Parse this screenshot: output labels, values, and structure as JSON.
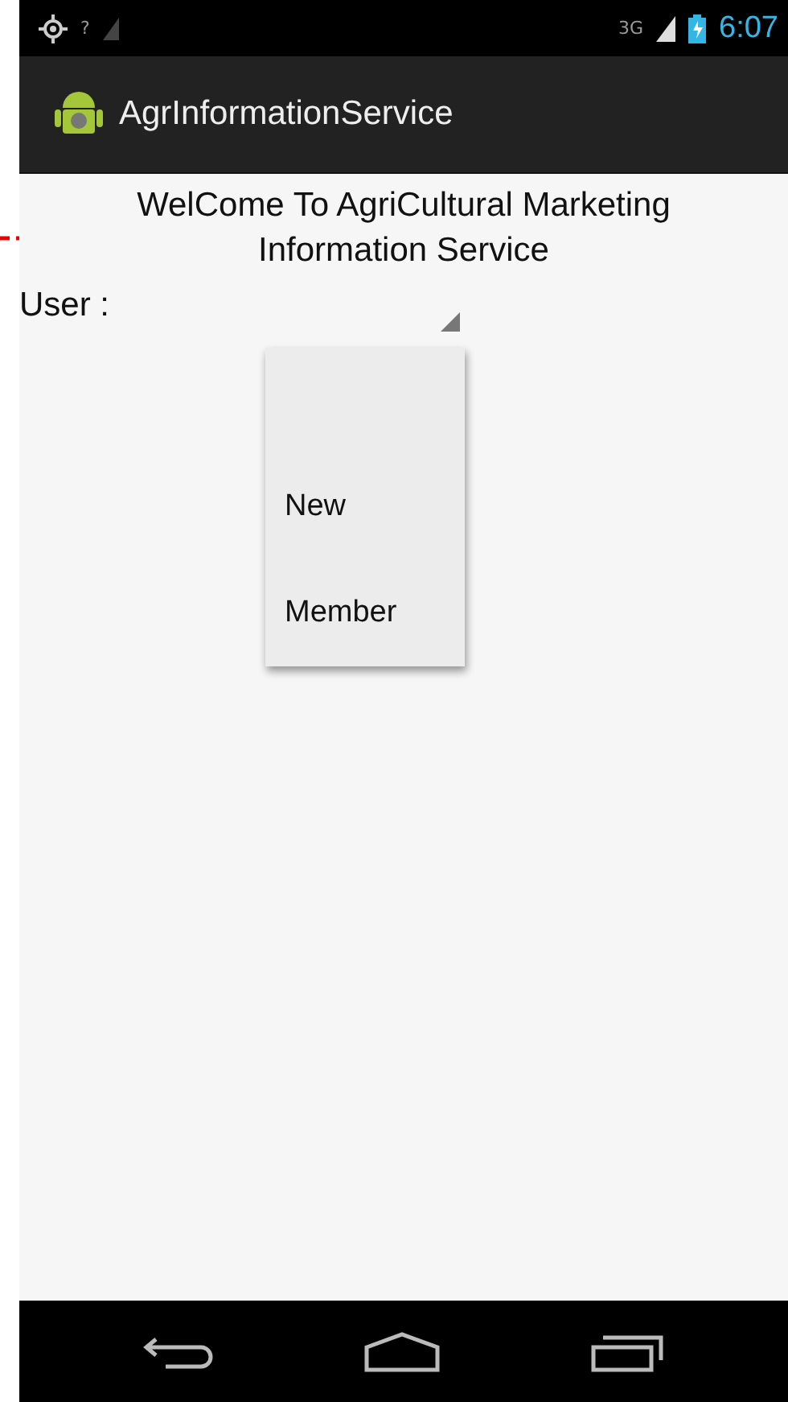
{
  "status_bar": {
    "signal_label": "?",
    "network": "3G",
    "time": "6:07"
  },
  "action_bar": {
    "title": "AgrInformationService"
  },
  "heading": "WelCome To AgriCultural Marketing Information Service",
  "user_label": "User :",
  "dropdown": {
    "expanded": true,
    "options": [
      {
        "label": "New",
        "selected": false
      },
      {
        "label": "Member",
        "selected": false
      }
    ]
  }
}
